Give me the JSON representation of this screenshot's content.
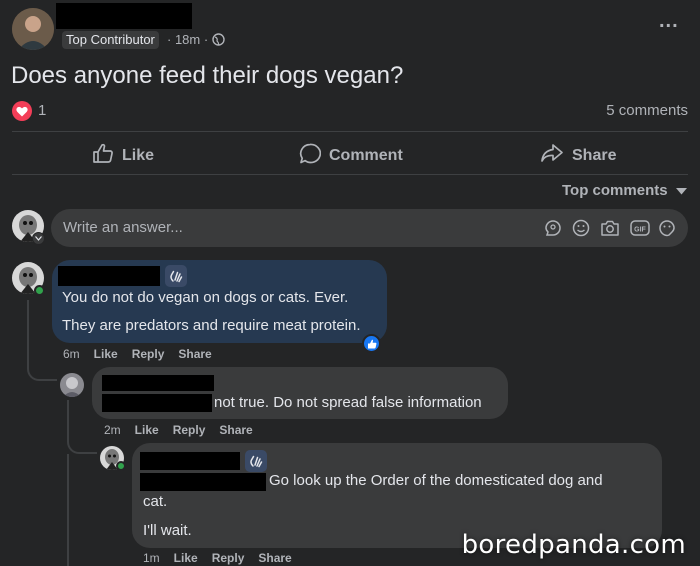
{
  "post": {
    "badge": "Top Contributor",
    "time": "· 18m ·",
    "more": "...",
    "title": "Does anyone feed their dogs vegan?",
    "reaction_count": "1",
    "comment_count": "5 comments"
  },
  "actions": {
    "like": "Like",
    "comment": "Comment",
    "share": "Share"
  },
  "sort_label": "Top comments",
  "composer": {
    "placeholder": "Write an answer..."
  },
  "comments": [
    {
      "lines": [
        "You do not do vegan on dogs or cats. Ever.",
        "They are predators and require meat protein."
      ],
      "time": "6m",
      "like": "Like",
      "reply": "Reply",
      "share": "Share"
    },
    {
      "text": "not true. Do not spread false information",
      "time": "2m",
      "like": "Like",
      "reply": "Reply",
      "share": "Share"
    },
    {
      "line1": "Go look up the Order of the domesticated dog and",
      "line2": "cat.",
      "line3": "I'll wait.",
      "time": "1m",
      "like": "Like",
      "reply": "Reply",
      "share": "Share"
    }
  ],
  "watermark": "boredpanda.com",
  "colors": {
    "background": "#242526",
    "highlight_bubble": "#263951",
    "bubble": "#3a3b3c",
    "like_blue": "#1877f2",
    "heart_red": "#f33e58"
  }
}
